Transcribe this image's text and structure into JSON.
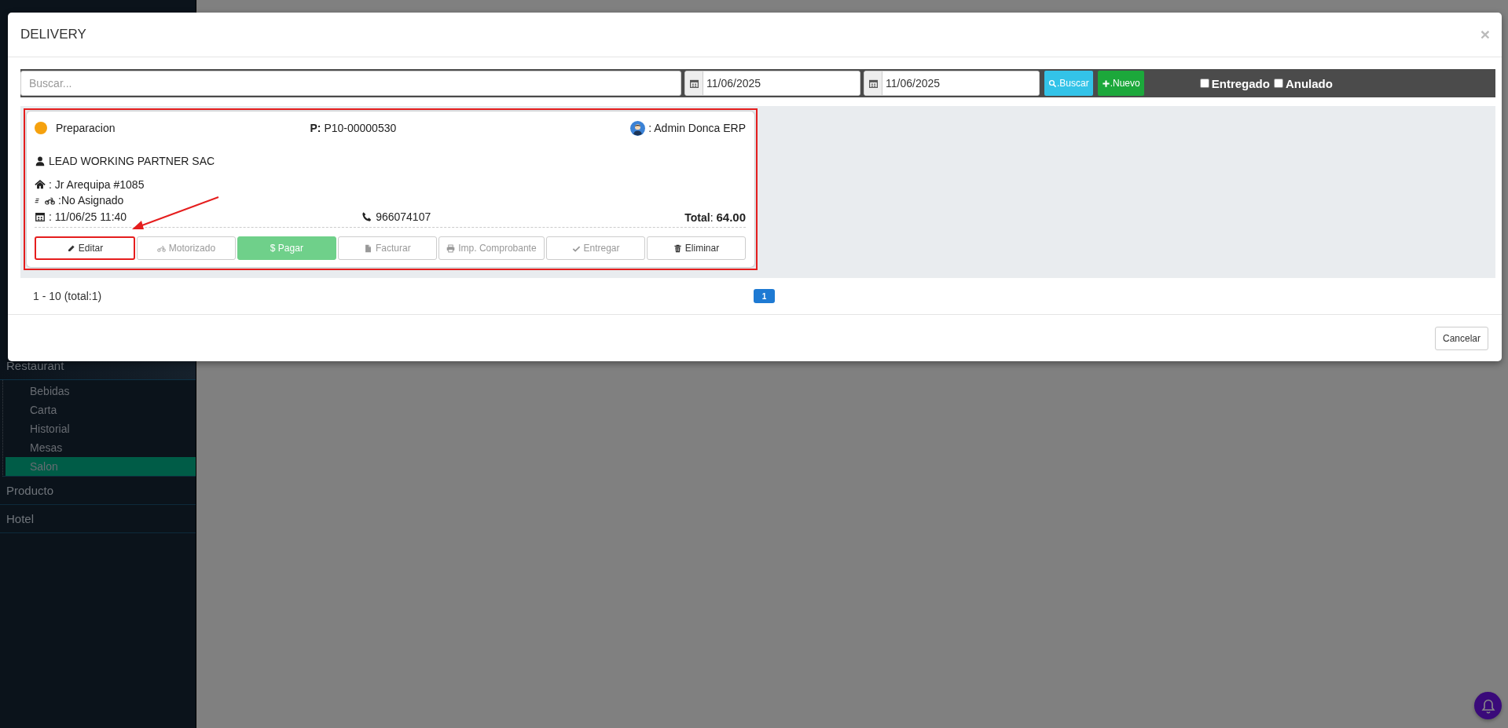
{
  "sidebar": {
    "items": [
      {
        "label": "Restaurant",
        "expanded": true,
        "children": [
          {
            "label": "Bebidas",
            "selected": false
          },
          {
            "label": "Carta",
            "selected": false
          },
          {
            "label": "Historial",
            "selected": false
          },
          {
            "label": "Mesas",
            "selected": false
          },
          {
            "label": "Salon",
            "selected": true
          }
        ]
      },
      {
        "label": "Producto"
      },
      {
        "label": "Hotel"
      }
    ]
  },
  "modal": {
    "title": "DELIVERY",
    "close": "×",
    "toolbar": {
      "search": {
        "placeholder": "Buscar..."
      },
      "date_from": "11/06/2025",
      "date_to": "11/06/2025",
      "buttons": [
        {
          "label": ".Buscar",
          "kind": "search"
        },
        {
          "label": ".Nuevo",
          "kind": "new"
        }
      ],
      "filters": [
        {
          "label": "Entregado",
          "checked": false
        },
        {
          "label": "Anulado",
          "checked": false
        }
      ]
    },
    "orders": [
      {
        "highlighted": true,
        "status": "Preparacion",
        "color": "#f5a10e",
        "order": "**P:** P10-00000530",
        "user": ": Admin Donca ERP",
        "customer": "LEAD WORKING PARTNER SAC",
        "address": ": Jr Arequipa #1085",
        "driver": ":No Asignado",
        "date": ": 11/06/25 11:40",
        "phone": "966074107",
        "total": "**Total**: **64.00**",
        "actions": [
          {
            "label": "Editar",
            "kind": "edit",
            "disabled": false,
            "highlighted": true
          },
          {
            "label": "Motorizado",
            "kind": "driver",
            "disabled": true,
            "highlighted": false
          },
          {
            "label": "$ Pagar",
            "kind": "pay",
            "disabled": true,
            "highlighted": false
          },
          {
            "label": "Facturar",
            "kind": "invoice",
            "disabled": true,
            "highlighted": false
          },
          {
            "label": "Imp. Comprobante",
            "kind": "print",
            "disabled": true,
            "highlighted": false
          },
          {
            "label": "Entregar",
            "kind": "deliver",
            "disabled": true,
            "highlighted": false
          },
          {
            "label": "Eliminar",
            "kind": "delete",
            "disabled": false,
            "highlighted": false
          }
        ]
      }
    ],
    "pagination": {
      "range": "1 - 10 (total:1)",
      "pages": [
        {
          "label": "1",
          "selected": true
        }
      ]
    },
    "footer": {
      "buttons": [
        {
          "label": "Cancelar"
        }
      ]
    }
  }
}
